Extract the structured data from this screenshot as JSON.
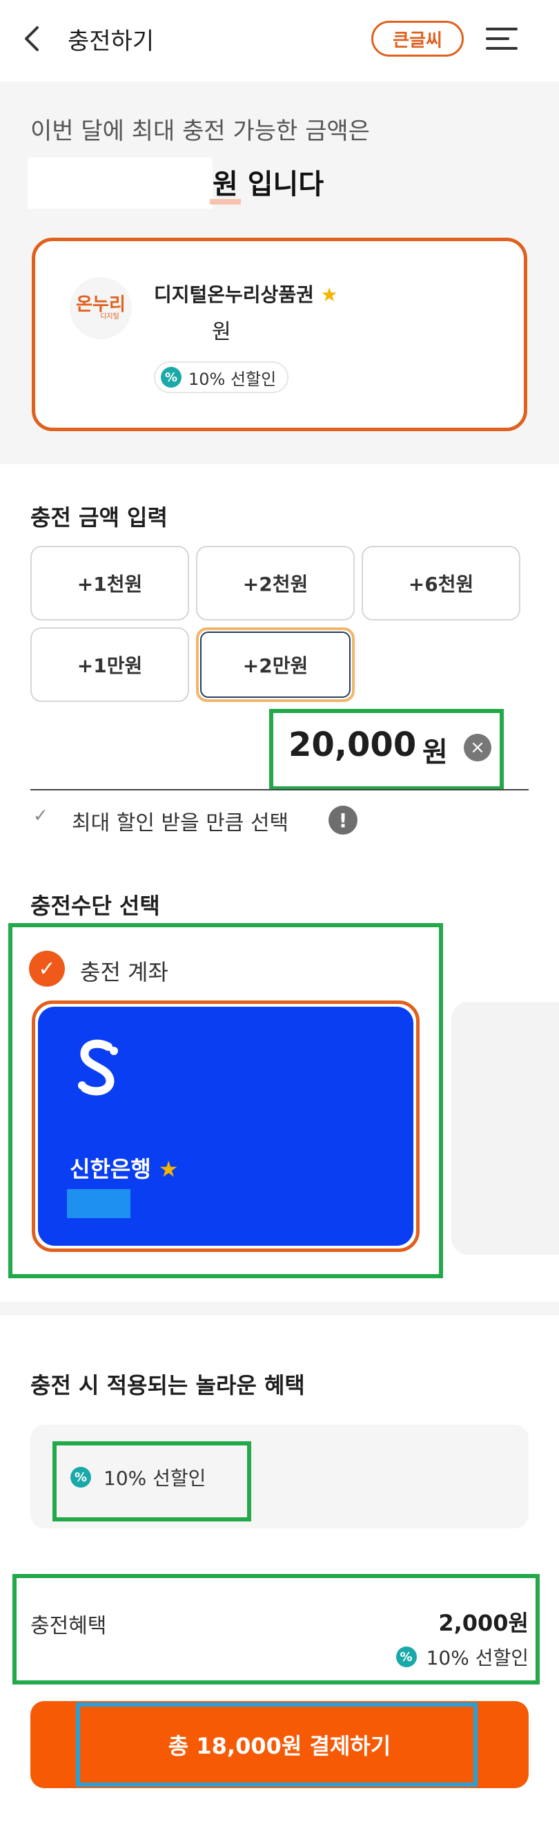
{
  "header": {
    "title": "충전하기",
    "big_text_button": "큰글씨"
  },
  "limit": {
    "line1": "이번 달에 최대 충전 가능한 금액은",
    "unit": "원",
    "suffix": " 입니다"
  },
  "voucher": {
    "logo_main": "온누리",
    "logo_sub": "디지털",
    "name": "디지털온누리상품권",
    "balance_unit": "원",
    "badge": "10% 선할인"
  },
  "amount_section": {
    "title": "충전 금액 입력",
    "buttons": [
      "+1천원",
      "+2천원",
      "+6천원",
      "+1만원",
      "+2만원"
    ],
    "selected": "+2만원",
    "value": "20,000",
    "unit": "원",
    "max_option": "최대 할인 받을 만큼 선택"
  },
  "payment_section": {
    "title": "충전수단 선택",
    "account_label": "충전 계좌",
    "bank_name": "신한은행"
  },
  "benefits_section": {
    "title": "충전 시 적용되는 놀라운 혜택",
    "item": "10% 선할인"
  },
  "summary": {
    "label": "충전혜택",
    "value": "2,000원",
    "badge": "10% 선할인"
  },
  "pay_button": "총 18,000원 결제하기",
  "colors": {
    "accent": "#e0601e",
    "pay_button": "#f65a05",
    "bank_card": "#0a3ef2",
    "discount_icon": "#1aa8a8",
    "highlight_green": "#23a84a",
    "highlight_blue": "#2aa0d8"
  },
  "icons": [
    "back-icon",
    "menu-icon",
    "star-icon",
    "percent-icon",
    "clear-icon",
    "check-icon",
    "info-icon",
    "bank-logo-icon"
  ]
}
